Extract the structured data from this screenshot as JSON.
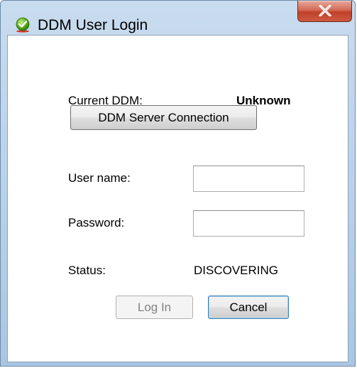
{
  "window": {
    "title": "DDM User Login",
    "icon": "green-checkmark-icon",
    "close_symbol": "x-icon"
  },
  "form": {
    "current_ddm_label": "Current DDM:",
    "current_ddm_value": "Unknown",
    "server_connection_button": "DDM Server Connection",
    "username_label": "User name:",
    "username_value": "",
    "password_label": "Password:",
    "password_value": "",
    "status_label": "Status:",
    "status_value": "DISCOVERING",
    "login_button": "Log In",
    "login_enabled": false,
    "cancel_button": "Cancel"
  },
  "colors": {
    "titlebar": "#b7cfe8",
    "close_button": "#c0402a",
    "disabled_text": "#838383",
    "focus_border": "#3c7fb1"
  }
}
